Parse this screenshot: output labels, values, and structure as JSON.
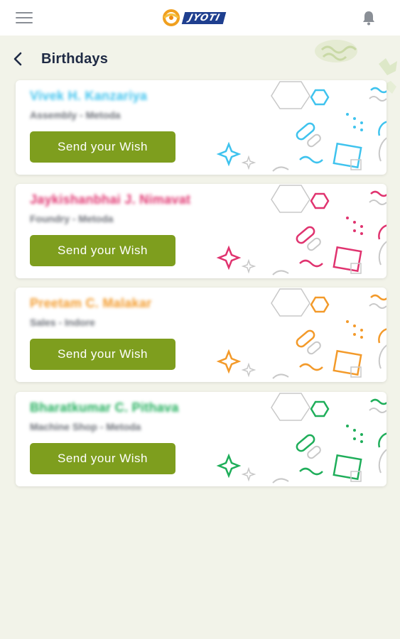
{
  "app": {
    "logo_text": "JYOTI"
  },
  "page": {
    "title": "Birthdays"
  },
  "birthdays": [
    {
      "name": "Vivek H. Kanzariya",
      "department": "Assembly - Metoda",
      "button_label": "Send your Wish",
      "accent": "#3fc3ee"
    },
    {
      "name": "Jaykishanbhai J. Nimavat",
      "department": "Foundry - Metoda",
      "button_label": "Send your Wish",
      "accent": "#e0336f"
    },
    {
      "name": "Preetam C. Malakar",
      "department": "Sales - Indore",
      "button_label": "Send your Wish",
      "accent": "#f39a2a"
    },
    {
      "name": "Bharatkumar C. Pithava",
      "department": "Machine Shop - Metoda",
      "button_label": "Send your Wish",
      "accent": "#1fae5a"
    }
  ],
  "colors": {
    "background": "#f2f3e9",
    "button": "#7e9e1e",
    "title": "#1f2a44"
  },
  "icons": [
    "menu-icon",
    "logo-icon",
    "bell-icon",
    "back-arrow-icon"
  ]
}
